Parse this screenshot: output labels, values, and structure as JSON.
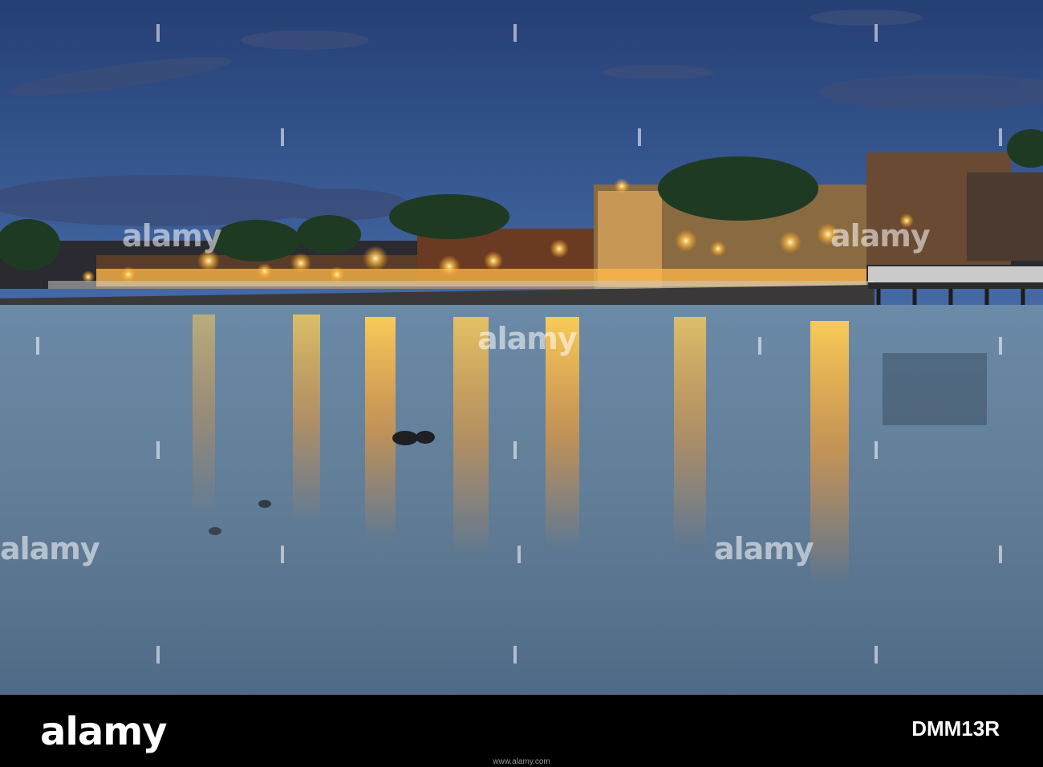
{
  "watermark": {
    "text": "alamy"
  },
  "footer": {
    "brand": "alamy",
    "image_id": "DMM13R",
    "caption_line": "www.alamy.com"
  },
  "colors": {
    "sky_top": "#1c3a6e",
    "sky_bottom": "#5b86c2",
    "water": "#5f7f9a",
    "light_glow": "#ffb530"
  }
}
